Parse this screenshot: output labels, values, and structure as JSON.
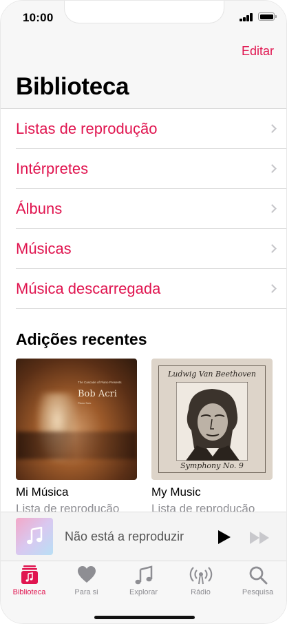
{
  "status_bar": {
    "time": "10:00"
  },
  "header": {
    "edit_label": "Editar",
    "title": "Biblioteca"
  },
  "library": {
    "items": [
      {
        "label": "Listas de reprodução"
      },
      {
        "label": "Intérpretes"
      },
      {
        "label": "Álbuns"
      },
      {
        "label": "Músicas"
      },
      {
        "label": "Música descarregada"
      }
    ]
  },
  "recent": {
    "title": "Adições recentes",
    "albums": [
      {
        "name": "Mi Música",
        "kind": "Lista de reprodução",
        "cover_title": "Bob Acri",
        "cover_small_text": "The Cascade of Piano Presents",
        "cover_sub_text": "Piano Solo"
      },
      {
        "name": "My Music",
        "kind": "Lista de reprodução",
        "cover_top_text": "Ludwig Van Beethoven",
        "cover_bottom_text": "Symphony No. 9"
      }
    ]
  },
  "mini_player": {
    "title": "Não está a reproduzir"
  },
  "tab_bar": {
    "tabs": [
      {
        "label": "Biblioteca",
        "icon": "library-icon",
        "active": true
      },
      {
        "label": "Para si",
        "icon": "heart-icon"
      },
      {
        "label": "Explorar",
        "icon": "music-note-icon"
      },
      {
        "label": "Rádio",
        "icon": "radio-icon"
      },
      {
        "label": "Pesquisa",
        "icon": "search-icon"
      }
    ]
  },
  "colors": {
    "accent": "#e0144f",
    "secondary_text": "#8e8e93"
  }
}
